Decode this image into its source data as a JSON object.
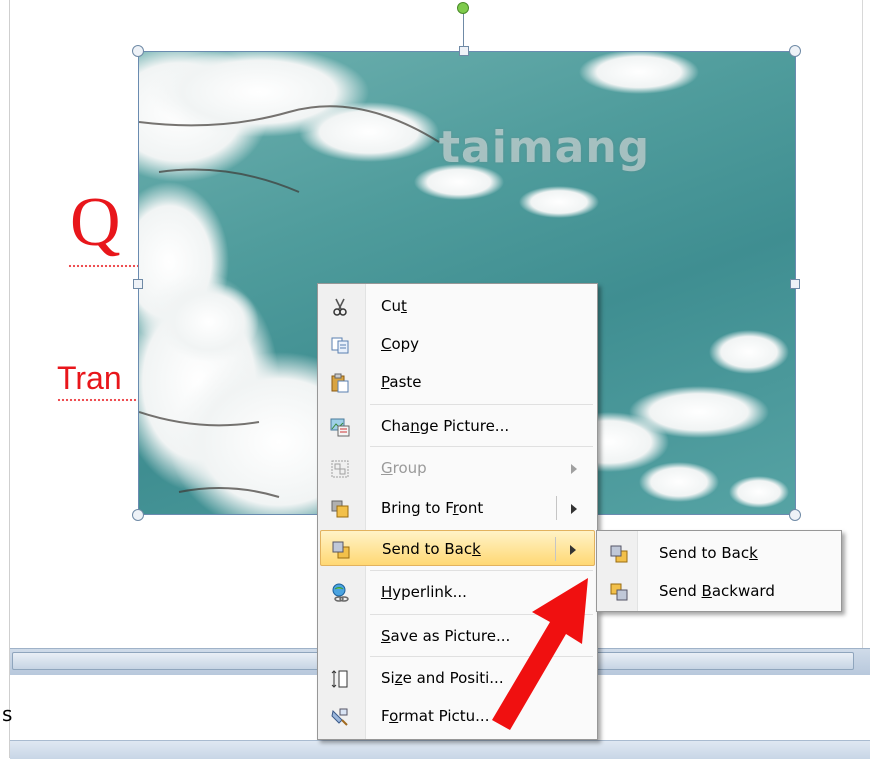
{
  "slide": {
    "title_char": "Q",
    "subtitle_fragment": "Tran",
    "notes_fragment": "s"
  },
  "picture": {
    "watermark": "taimang"
  },
  "context_menu": {
    "items": [
      {
        "label_pre": "Cu",
        "label_u": "t",
        "label_post": "",
        "icon": "scissors-icon"
      },
      {
        "label_pre": "",
        "label_u": "C",
        "label_post": "opy",
        "icon": "copy-icon"
      },
      {
        "label_pre": "",
        "label_u": "P",
        "label_post": "aste",
        "icon": "paste-icon"
      },
      {
        "label_pre": "Cha",
        "label_u": "n",
        "label_post": "ge Picture...",
        "icon": "change-picture-icon"
      },
      {
        "label_pre": "",
        "label_u": "G",
        "label_post": "roup",
        "icon": "group-icon",
        "disabled": true
      },
      {
        "label_pre": "Bring to F",
        "label_u": "r",
        "label_post": "ont",
        "icon": "bring-to-front-icon"
      },
      {
        "label_pre": "Send to Bac",
        "label_u": "k",
        "label_post": "",
        "icon": "send-to-back-icon",
        "highlighted": true
      },
      {
        "label_pre": "",
        "label_u": "H",
        "label_post": "yperlink...",
        "icon": "hyperlink-icon"
      },
      {
        "label_pre": "",
        "label_u": "S",
        "label_post": "ave as Picture...",
        "icon": "save-icon"
      },
      {
        "label_pre": "Si",
        "label_u": "z",
        "label_post": "e and Positi...",
        "icon": "size-position-icon"
      },
      {
        "label_pre": "F",
        "label_u": "o",
        "label_post": "rmat Pictu...",
        "icon": "format-picture-icon"
      }
    ]
  },
  "submenu": {
    "items": [
      {
        "label_pre": "Send to Bac",
        "label_u": "k",
        "label_post": "",
        "icon": "send-to-back-icon"
      },
      {
        "label_pre": "Send ",
        "label_u": "B",
        "label_post": "ackward",
        "icon": "send-backward-icon"
      }
    ]
  }
}
